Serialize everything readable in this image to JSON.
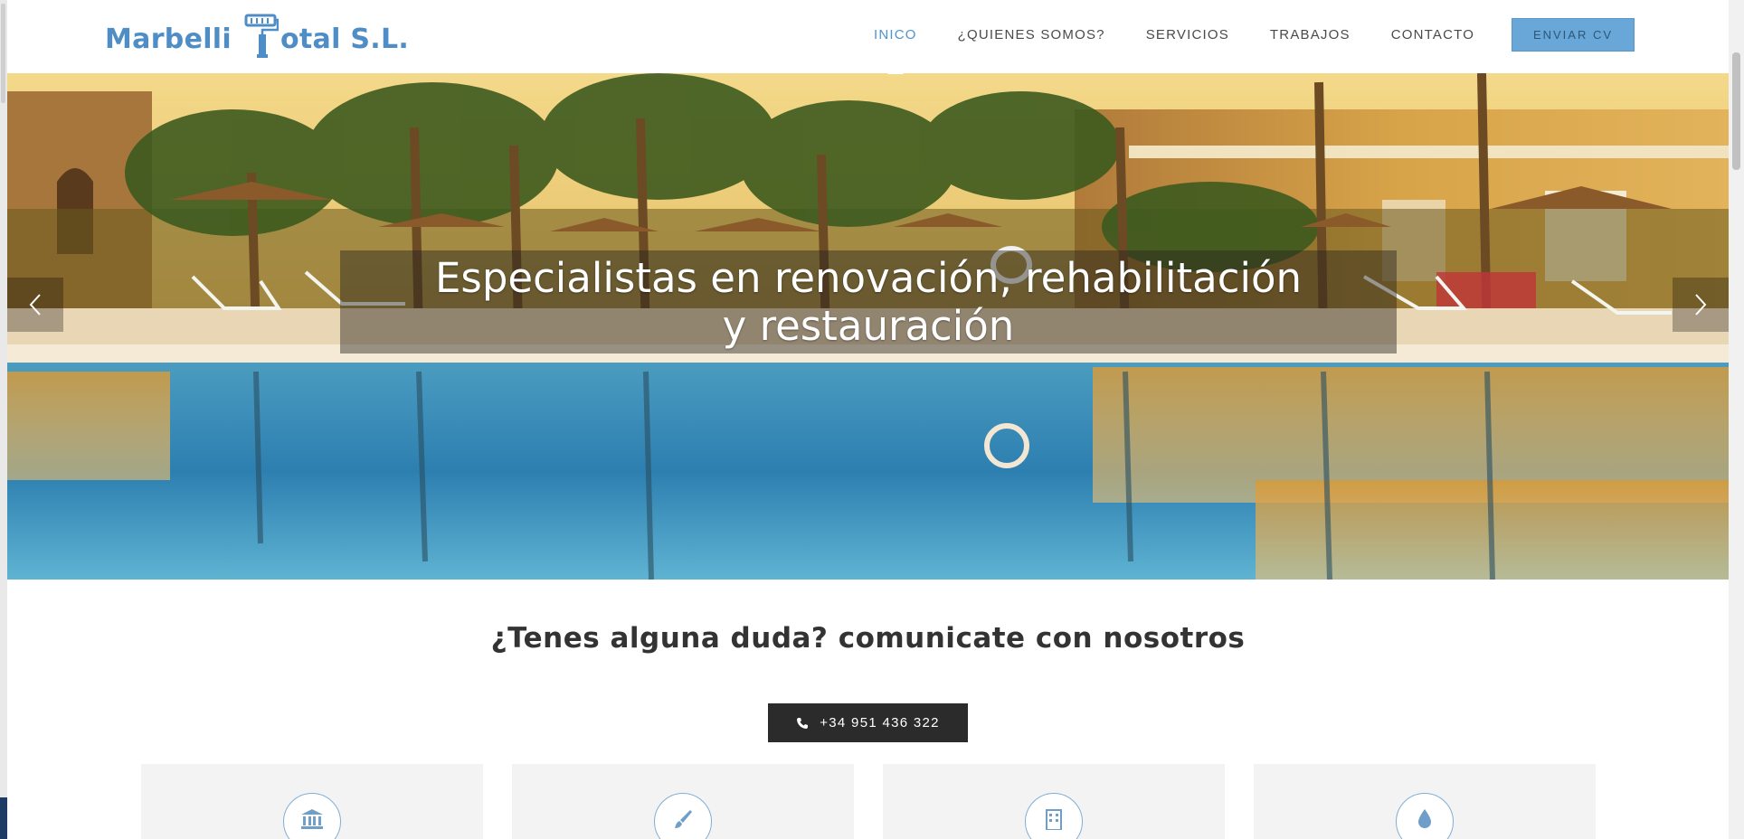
{
  "brand": {
    "name_part1": "Marbelli",
    "name_part2": "otal S.L.",
    "logo_icon": "paint-roller-T-icon",
    "color": "#4f8dc6"
  },
  "nav": {
    "items": [
      {
        "label": "INICO",
        "active": true
      },
      {
        "label": "¿QUIENES SOMOS?",
        "active": false
      },
      {
        "label": "SERVICIOS",
        "active": false
      },
      {
        "label": "TRABAJOS",
        "active": false
      },
      {
        "label": "CONTACTO",
        "active": false
      }
    ],
    "cv_button": "ENVIAR CV",
    "active_color": "#4f94cd"
  },
  "hero": {
    "caption": "Especialistas en renovación, rehabilitación y restauración",
    "prev_icon": "chevron-left-icon",
    "next_icon": "chevron-right-icon"
  },
  "contact": {
    "heading": "¿Tenes alguna duda? comunicate con nosotros",
    "phone": "+34 951 436 322",
    "phone_icon": "phone-icon"
  },
  "services": {
    "cards": [
      {
        "icon": "building-columns-icon"
      },
      {
        "icon": "paint-brush-icon"
      },
      {
        "icon": "office-building-icon"
      },
      {
        "icon": "water-drop-icon"
      }
    ]
  }
}
